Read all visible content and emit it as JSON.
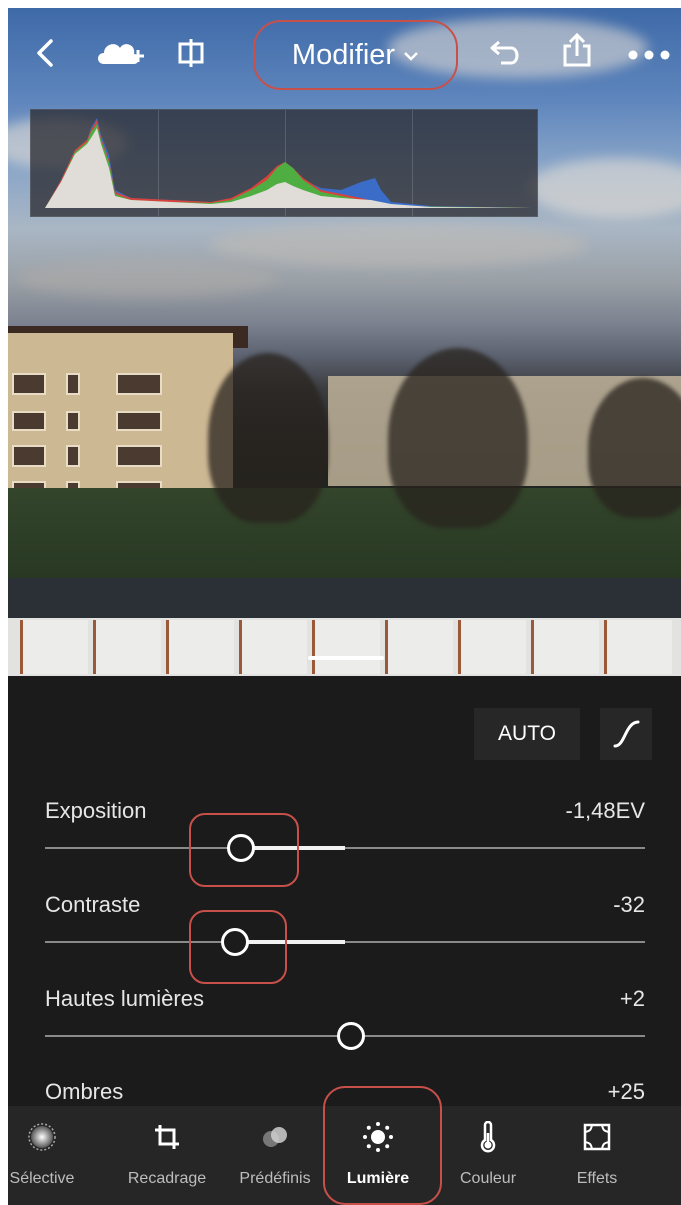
{
  "header": {
    "title": "Modifier",
    "icons": [
      "back-icon",
      "cloud-add-icon",
      "compare-icon",
      "chevron-down-icon",
      "undo-icon",
      "share-icon",
      "more-icon"
    ]
  },
  "panel": {
    "auto_label": "AUTO",
    "sliders": [
      {
        "label": "Exposition",
        "value": "-1,48EV",
        "position": 0.327,
        "zero": 0.5
      },
      {
        "label": "Contraste",
        "value": "-32",
        "position": 0.316,
        "zero": 0.5
      },
      {
        "label": "Hautes lumières",
        "value": "+2",
        "position": 0.51,
        "zero": 0.5
      },
      {
        "label": "Ombres",
        "value": "+25"
      }
    ]
  },
  "tools": [
    {
      "label": "Sélective",
      "icon": "selective-icon"
    },
    {
      "label": "Recadrage",
      "icon": "crop-icon"
    },
    {
      "label": "Prédéfinis",
      "icon": "presets-icon"
    },
    {
      "label": "Lumière",
      "icon": "light-icon",
      "active": true
    },
    {
      "label": "Couleur",
      "icon": "thermometer-icon"
    },
    {
      "label": "Effets",
      "icon": "effects-icon"
    }
  ],
  "colors": {
    "highlight": "#c8504a",
    "panel": "#1b1b1b",
    "toolbar": "#262626"
  }
}
